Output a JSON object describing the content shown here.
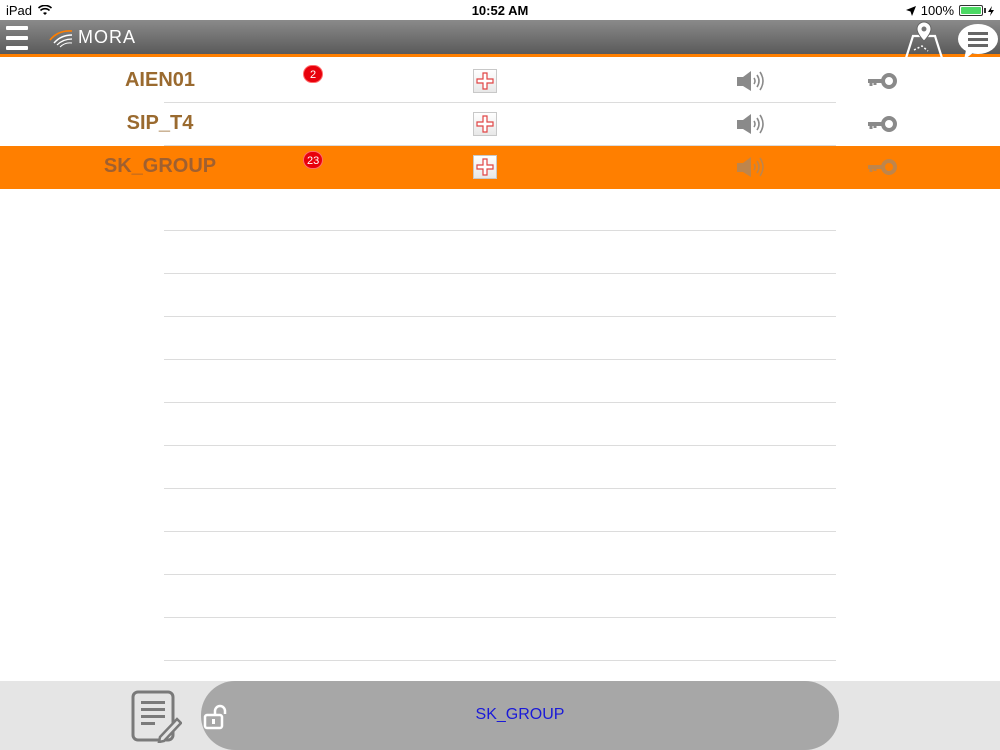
{
  "status_bar": {
    "device": "iPad",
    "time": "10:52 AM",
    "battery": "100%",
    "battery_level": 1.0,
    "wifi_icon": "wifi-icon",
    "location_icon": "location-arrow-icon"
  },
  "nav_bar": {
    "menu_icon": "hamburger-menu-icon",
    "logo_text": "MORA",
    "map_icon": "map-pin-icon",
    "chat_icon": "chat-bubble-icon"
  },
  "colors": {
    "accent": "#ff7f00",
    "name_text": "#9a6a2f",
    "badge": "#e8000b",
    "selected_label": "#1a1ad8"
  },
  "groups": [
    {
      "name": "AIEN01",
      "badge": "2",
      "selected": false
    },
    {
      "name": "SIP_T4",
      "badge": "",
      "selected": false
    },
    {
      "name": "SK_GROUP",
      "badge": "23",
      "selected": true
    }
  ],
  "row_icons": {
    "add": "add-plus-icon",
    "speaker": "speaker-icon",
    "key": "key-icon"
  },
  "bottom_bar": {
    "notes_icon": "notes-edit-icon",
    "lock_icon": "unlock-icon",
    "selected_group": "SK_GROUP"
  }
}
